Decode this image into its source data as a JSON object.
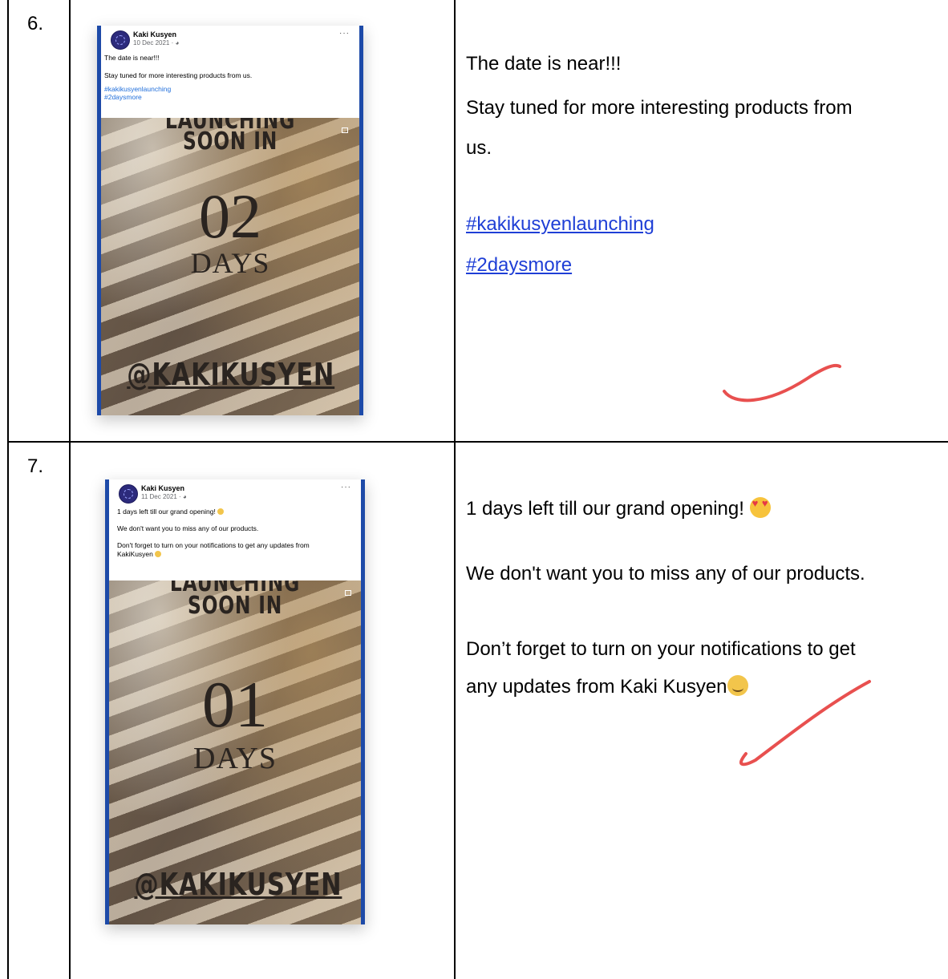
{
  "rows": [
    {
      "number": "6.",
      "post": {
        "author": "Kaki Kusyen",
        "date": "10 Dec 2021 · ",
        "menu_icon": "more-options-icon",
        "text_lines": [
          "The date is near!!!",
          "Stay tuned for more interesting products from us."
        ],
        "hashtags": [
          "#kakikusyenlaunching",
          "#2daysmore"
        ],
        "poster": {
          "title_top": "LAUNCHING",
          "title_bottom": "SOON IN",
          "count": "02",
          "unit": "DAYS",
          "handle": "@KAKIKUSYEN"
        }
      },
      "caption": {
        "line1": "The date is near!!!",
        "line2": "Stay tuned for more interesting products from",
        "line3": "us.",
        "tag1": "#kakikusyenlaunching",
        "tag2": "#2daysmore"
      }
    },
    {
      "number": "7.",
      "post": {
        "author": "Kaki Kusyen",
        "date": "11 Dec 2021 · ",
        "menu_icon": "more-options-icon",
        "text_line1": "1 days left till our grand opening!",
        "text_line2": "We don't want you to miss any of our products.",
        "text_line3": "Don't forget to turn on your notifications to get any updates from",
        "text_line4": "KakiKusyen",
        "poster": {
          "title_top": "LAUNCHING",
          "title_bottom": "SOON IN",
          "count": "01",
          "unit": "DAYS",
          "handle": "@KAKIKUSYEN"
        }
      },
      "caption": {
        "line1": "1 days left till our grand opening!",
        "line2": "We don't want you to miss any of our products.",
        "line3": "Don’t forget to turn on your notifications to get",
        "line4": "any updates from Kaki Kusyen",
        "emoji1": "heart-eyes-emoji",
        "emoji2": "blushing-emoji"
      }
    }
  ],
  "annotation_color": "#e8504f",
  "hashtag_color": "#1f3fd6"
}
